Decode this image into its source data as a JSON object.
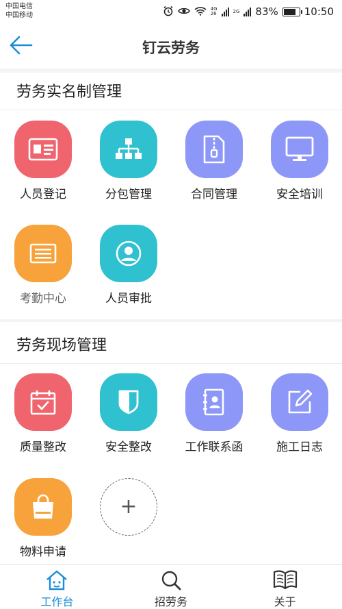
{
  "status_bar": {
    "carrier_1": "中国电信",
    "carrier_2": "中国移动",
    "net_a_top": "4G",
    "net_a_bottom": "26",
    "net_b": "2G",
    "battery": "83%",
    "battery_level": 0.83,
    "time": "10:50"
  },
  "nav": {
    "title": "钉云劳务"
  },
  "section_1": {
    "title": "劳务实名制管理",
    "items": [
      {
        "label": "人员登记",
        "icon": "id-card-icon",
        "color": "#f0646e"
      },
      {
        "label": "分包管理",
        "icon": "org-chart-icon",
        "color": "#2fc1d0"
      },
      {
        "label": "合同管理",
        "icon": "document-zip-icon",
        "color": "#8d97f7"
      },
      {
        "label": "安全培训",
        "icon": "monitor-icon",
        "color": "#8d97f7"
      },
      {
        "label": "考勤中心",
        "icon": "list-card-icon",
        "color": "#f7a23a"
      },
      {
        "label": "人员审批",
        "icon": "user-circle-icon",
        "color": "#2fc1d0"
      }
    ]
  },
  "section_2": {
    "title": "劳务现场管理",
    "items": [
      {
        "label": "质量整改",
        "icon": "calendar-check-icon",
        "color": "#f0646e"
      },
      {
        "label": "安全整改",
        "icon": "shield-icon",
        "color": "#2fc1d0"
      },
      {
        "label": "工作联系函",
        "icon": "contacts-book-icon",
        "color": "#8d97f7"
      },
      {
        "label": "施工日志",
        "icon": "edit-icon",
        "color": "#8d97f7"
      },
      {
        "label": "物料申请",
        "icon": "shopping-bag-icon",
        "color": "#f7a23a"
      }
    ],
    "add_button": "+"
  },
  "tabbar": {
    "accent": "#1a8dd8",
    "tabs": [
      {
        "label": "工作台",
        "icon": "home-icon",
        "active": true
      },
      {
        "label": "招劳务",
        "icon": "search-icon",
        "active": false
      },
      {
        "label": "关于",
        "icon": "book-icon",
        "active": false
      }
    ]
  }
}
